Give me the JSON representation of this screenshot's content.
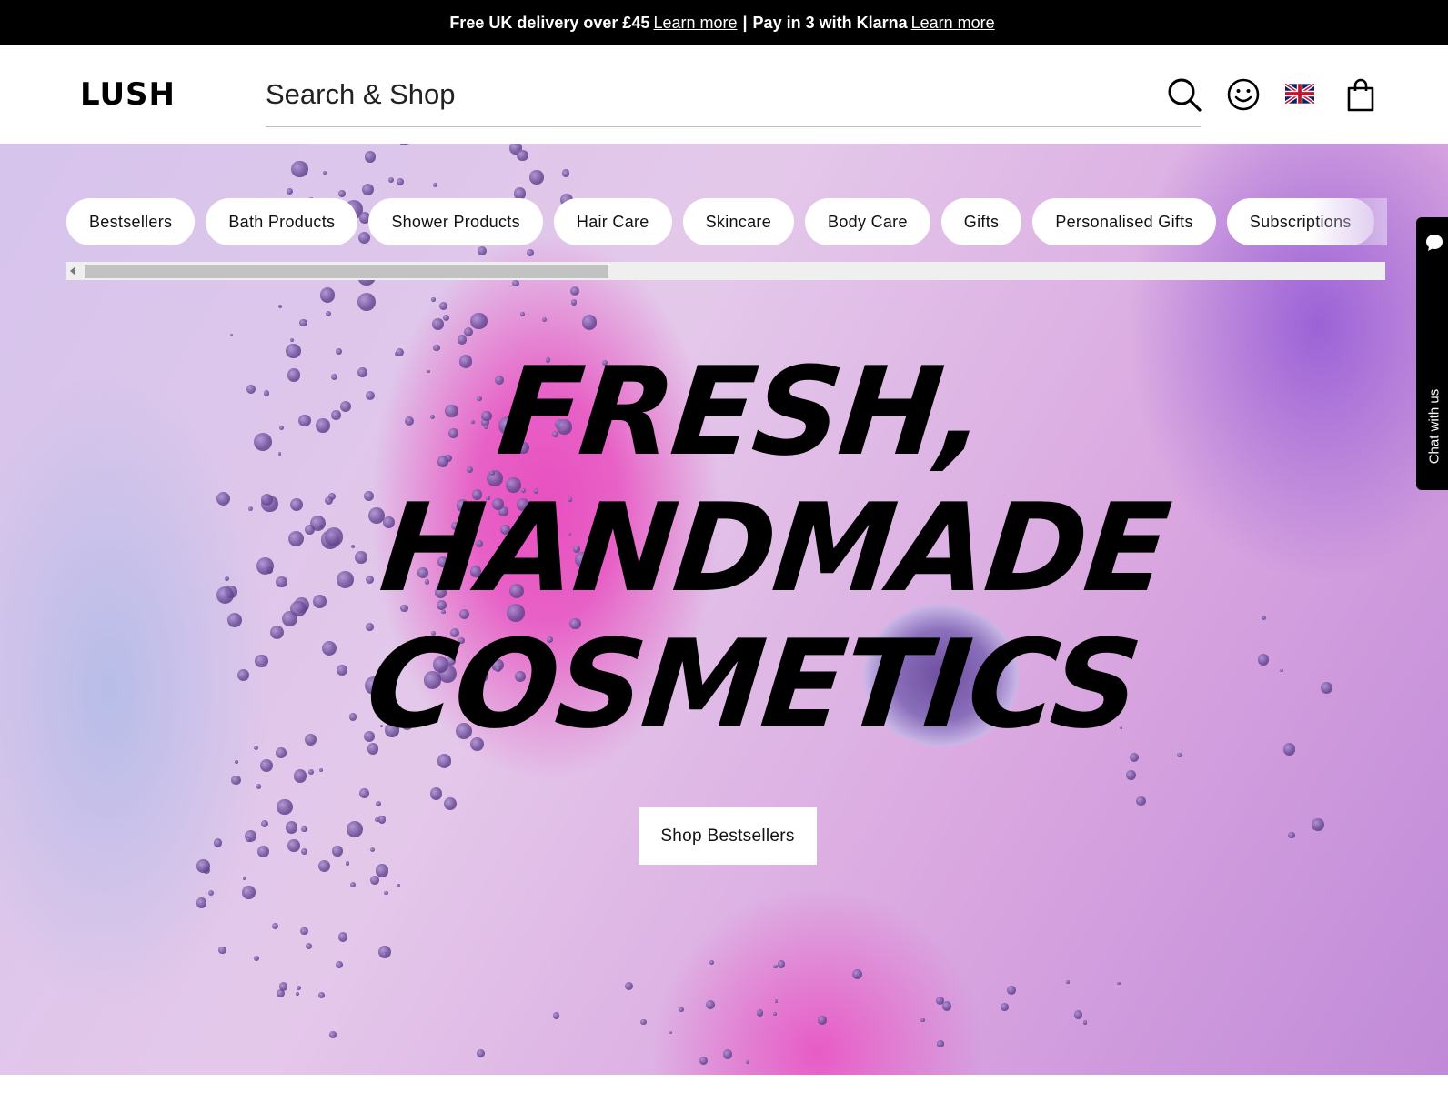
{
  "announcement": {
    "delivery_text": "Free UK delivery over £45",
    "delivery_link": "Learn more",
    "separator": "|",
    "klarna_text": "Pay in 3 with Klarna",
    "klarna_link": "Learn more"
  },
  "header": {
    "logo": "LUSH",
    "search_placeholder": "Search & Shop",
    "icons": [
      "search-icon",
      "account-icon",
      "uk-flag-icon",
      "shopping-bag-icon"
    ]
  },
  "categories": [
    {
      "label": "Bestsellers"
    },
    {
      "label": "Bath Products"
    },
    {
      "label": "Shower Products"
    },
    {
      "label": "Hair Care"
    },
    {
      "label": "Skincare"
    },
    {
      "label": "Body Care"
    },
    {
      "label": "Gifts"
    },
    {
      "label": "Personalised Gifts"
    },
    {
      "label": "Subscriptions"
    }
  ],
  "hero": {
    "headline_line1": "FRESH,",
    "headline_line2": "HANDMADE",
    "headline_line3": "COSMETICS",
    "cta_label": "Shop Bestsellers"
  },
  "chat": {
    "label": "Chat with us"
  },
  "colors": {
    "announcement_bg": "#000000",
    "pill_bg": "#ffffff",
    "hero_pink": "#e84fc0",
    "hero_purple": "#8a6fbb"
  }
}
